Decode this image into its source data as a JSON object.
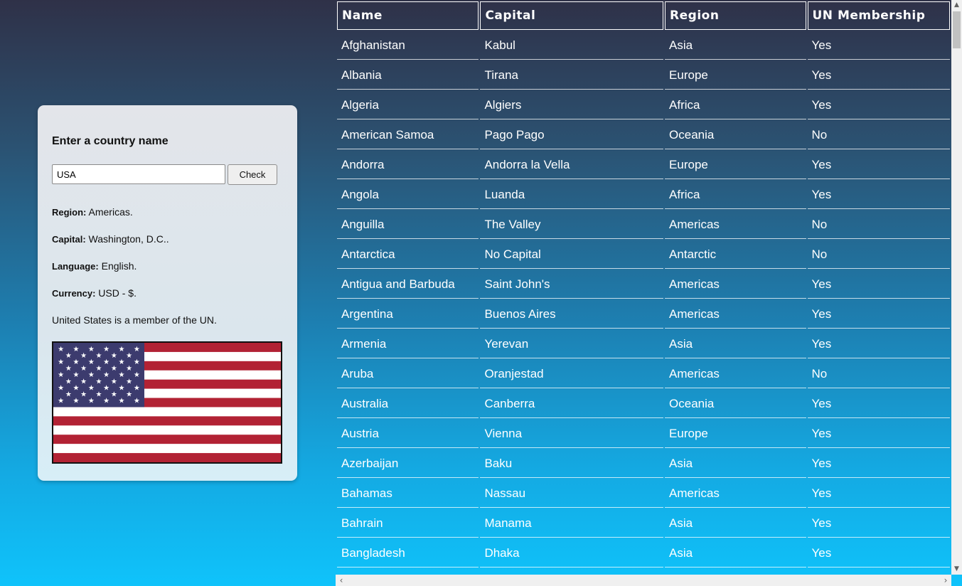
{
  "lookup": {
    "title": "Enter a country name",
    "input_value": "USA",
    "check_label": "Check",
    "region_label": "Region:",
    "region_value": " Americas.",
    "capital_label": "Capital:",
    "capital_value": " Washington, D.C..",
    "language_label": "Language:",
    "language_value": " English.",
    "currency_label": "Currency:",
    "currency_value": " USD - $.",
    "membership_text": "United States is a member of the UN.",
    "flag": "us-flag-icon"
  },
  "table": {
    "headers": [
      "Name",
      "Capital",
      "Region",
      "UN Membership"
    ],
    "rows": [
      [
        "Afghanistan",
        "Kabul",
        "Asia",
        "Yes"
      ],
      [
        "Albania",
        "Tirana",
        "Europe",
        "Yes"
      ],
      [
        "Algeria",
        "Algiers",
        "Africa",
        "Yes"
      ],
      [
        "American Samoa",
        "Pago Pago",
        "Oceania",
        "No"
      ],
      [
        "Andorra",
        "Andorra la Vella",
        "Europe",
        "Yes"
      ],
      [
        "Angola",
        "Luanda",
        "Africa",
        "Yes"
      ],
      [
        "Anguilla",
        "The Valley",
        "Americas",
        "No"
      ],
      [
        "Antarctica",
        "No Capital",
        "Antarctic",
        "No"
      ],
      [
        "Antigua and Barbuda",
        "Saint John's",
        "Americas",
        "Yes"
      ],
      [
        "Argentina",
        "Buenos Aires",
        "Americas",
        "Yes"
      ],
      [
        "Armenia",
        "Yerevan",
        "Asia",
        "Yes"
      ],
      [
        "Aruba",
        "Oranjestad",
        "Americas",
        "No"
      ],
      [
        "Australia",
        "Canberra",
        "Oceania",
        "Yes"
      ],
      [
        "Austria",
        "Vienna",
        "Europe",
        "Yes"
      ],
      [
        "Azerbaijan",
        "Baku",
        "Asia",
        "Yes"
      ],
      [
        "Bahamas",
        "Nassau",
        "Americas",
        "Yes"
      ],
      [
        "Bahrain",
        "Manama",
        "Asia",
        "Yes"
      ],
      [
        "Bangladesh",
        "Dhaka",
        "Asia",
        "Yes"
      ]
    ]
  }
}
